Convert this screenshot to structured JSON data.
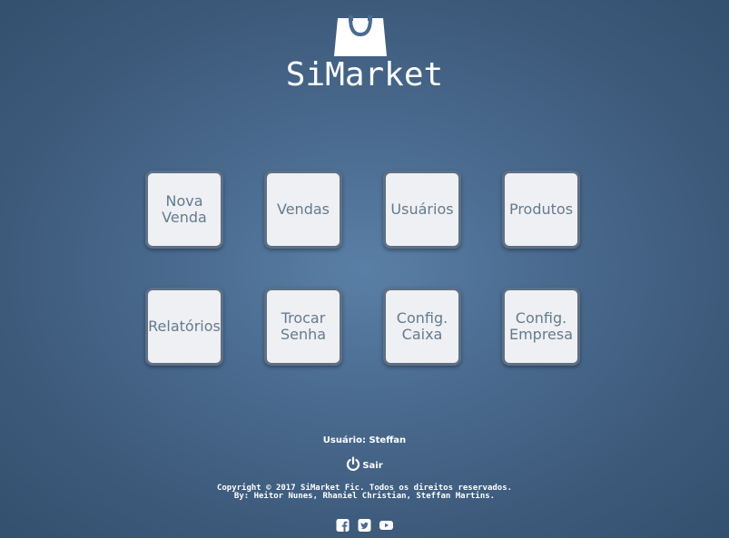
{
  "app": {
    "brand_name": "SiMarket",
    "logo_icon": "shopping-bag-icon"
  },
  "menu": {
    "tiles": [
      {
        "id": "nova-venda",
        "label": "Nova\nVenda"
      },
      {
        "id": "vendas",
        "label": "Vendas"
      },
      {
        "id": "usuarios",
        "label": "Usuários"
      },
      {
        "id": "produtos",
        "label": "Produtos"
      },
      {
        "id": "relatorios",
        "label": "Relatórios"
      },
      {
        "id": "trocar-senha",
        "label": "Trocar\nSenha"
      },
      {
        "id": "config-caixa",
        "label": "Config.\nCaixa"
      },
      {
        "id": "config-empresa",
        "label": "Config.\nEmpresa"
      }
    ]
  },
  "footer": {
    "user_text": "Usuário: Steffan",
    "logout_label": "Sair",
    "logout_icon": "power-icon",
    "copyright_line1": "Copyright © 2017 SiMarket Fic. Todos os direitos reservados.",
    "copyright_line2": "By: Heitor Nunes, Rhaniel Christian, Steffan Martins.",
    "social_icons": [
      "facebook-icon",
      "twitter-icon",
      "youtube-icon"
    ]
  },
  "colors": {
    "background": "#4a6b8f",
    "tile_background": "#eef0f3",
    "tile_border": "#5d7086",
    "tile_text": "#667a8e",
    "footer_text": "#ffffff"
  }
}
